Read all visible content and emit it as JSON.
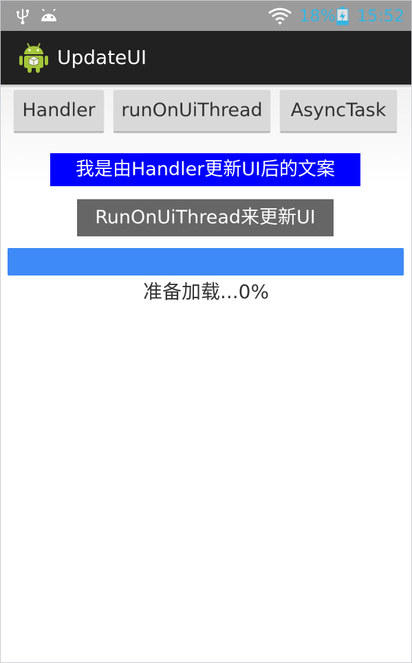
{
  "status_bar": {
    "icons": [
      "usb-icon",
      "android-debug-icon",
      "wifi-icon",
      "battery-icon"
    ],
    "battery_percent": "18%",
    "time": "15:52",
    "accent_color": "#33b5e5"
  },
  "action_bar": {
    "app_icon": "android-robot-icon",
    "title": "UpdateUI"
  },
  "buttons": {
    "handler": "Handler",
    "run_on_ui_thread": "runOnUiThread",
    "async_task": "AsyncTask"
  },
  "labels": {
    "handler_text": "我是由Handler更新UI后的文案",
    "handler_bg_color": "#0000ff",
    "run_on_ui_text": "RunOnUiThread来更新UI",
    "run_on_ui_bg_color": "#666666"
  },
  "progress": {
    "value_fraction": 1.0,
    "bar_color": "#3e8af7",
    "status_text": "准备加载...0%"
  }
}
